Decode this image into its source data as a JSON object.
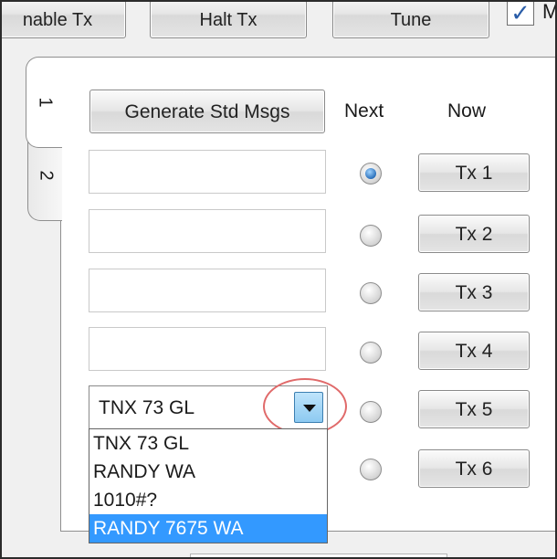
{
  "toolbar": {
    "enable_tx_label": "nable Tx",
    "halt_tx_label": "Halt Tx",
    "tune_label": "Tune",
    "check_mark": "✓",
    "check_label": "M"
  },
  "tabs": [
    {
      "label": "1",
      "active": true
    },
    {
      "label": "2",
      "active": false
    }
  ],
  "panel": {
    "generate_label": "Generate Std Msgs",
    "next_header": "Next",
    "now_header": "Now"
  },
  "messages": [
    {
      "text": "",
      "tx_label": "Tx 1",
      "next_selected": true
    },
    {
      "text": "",
      "tx_label": "Tx 2",
      "next_selected": false
    },
    {
      "text": "",
      "tx_label": "Tx 3",
      "next_selected": false
    },
    {
      "text": "",
      "tx_label": "Tx 4",
      "next_selected": false
    },
    {
      "text": "TNX 73 GL",
      "tx_label": "Tx 5",
      "next_selected": false
    },
    {
      "text": "",
      "tx_label": "Tx 6",
      "next_selected": false
    }
  ],
  "tx5_dropdown": {
    "options": [
      "TNX 73 GL",
      "RANDY WA",
      "1010#?",
      "RANDY 7675 WA"
    ],
    "highlighted": "RANDY 7675 WA"
  },
  "colors": {
    "selection": "#3399ff",
    "annotation_circle": "#e06a6a",
    "radio_checked": "#2369b6"
  }
}
